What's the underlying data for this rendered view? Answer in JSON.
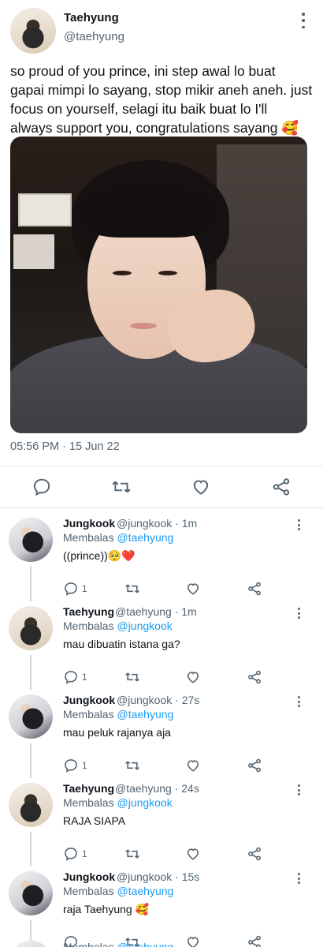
{
  "main_tweet": {
    "author_name": "Taehyung",
    "author_handle": "@taehyung",
    "text": "so proud of you prince, ini step awal lo buat gapai mimpi lo sayang, stop mikir aneh aneh. just focus on yourself, selagi itu baik buat lo I'll always support you, congratulations sayang 🥰",
    "timestamp": "05:56 PM · 15 Jun 22"
  },
  "replying_prefix": "Membalas",
  "replies": [
    {
      "name": "Jungkook",
      "handle": "@jungkook",
      "time": "· 1m",
      "replying_to": "@taehyung",
      "text": "((prince))🥺❤️",
      "reply_count": "1"
    },
    {
      "name": "Taehyung",
      "handle": "@taehyung",
      "time": "· 1m",
      "replying_to": "@jungkook",
      "text": "mau dibuatin istana ga?",
      "reply_count": "1"
    },
    {
      "name": "Jungkook",
      "handle": "@jungkook",
      "time": "· 27s",
      "replying_to": "@taehyung",
      "text": "mau peluk rajanya aja",
      "reply_count": "1"
    },
    {
      "name": "Taehyung",
      "handle": "@taehyung",
      "time": "· 24s",
      "replying_to": "@jungkook",
      "text": "RAJA SIAPA",
      "reply_count": "1"
    },
    {
      "name": "Jungkook",
      "handle": "@jungkook",
      "time": "· 15s",
      "replying_to": "@taehyung",
      "text": "raja Taehyung 🥰",
      "reply_count": ""
    }
  ],
  "partial_next": {
    "replying_to": "@taehyung"
  },
  "icons": {
    "reply": "reply-icon",
    "retweet": "retweet-icon",
    "like": "heart-icon",
    "share": "share-icon",
    "more": "more-icon"
  },
  "colors": {
    "link": "#1d9bf0",
    "secondary": "#536471",
    "text": "#0f1419"
  }
}
